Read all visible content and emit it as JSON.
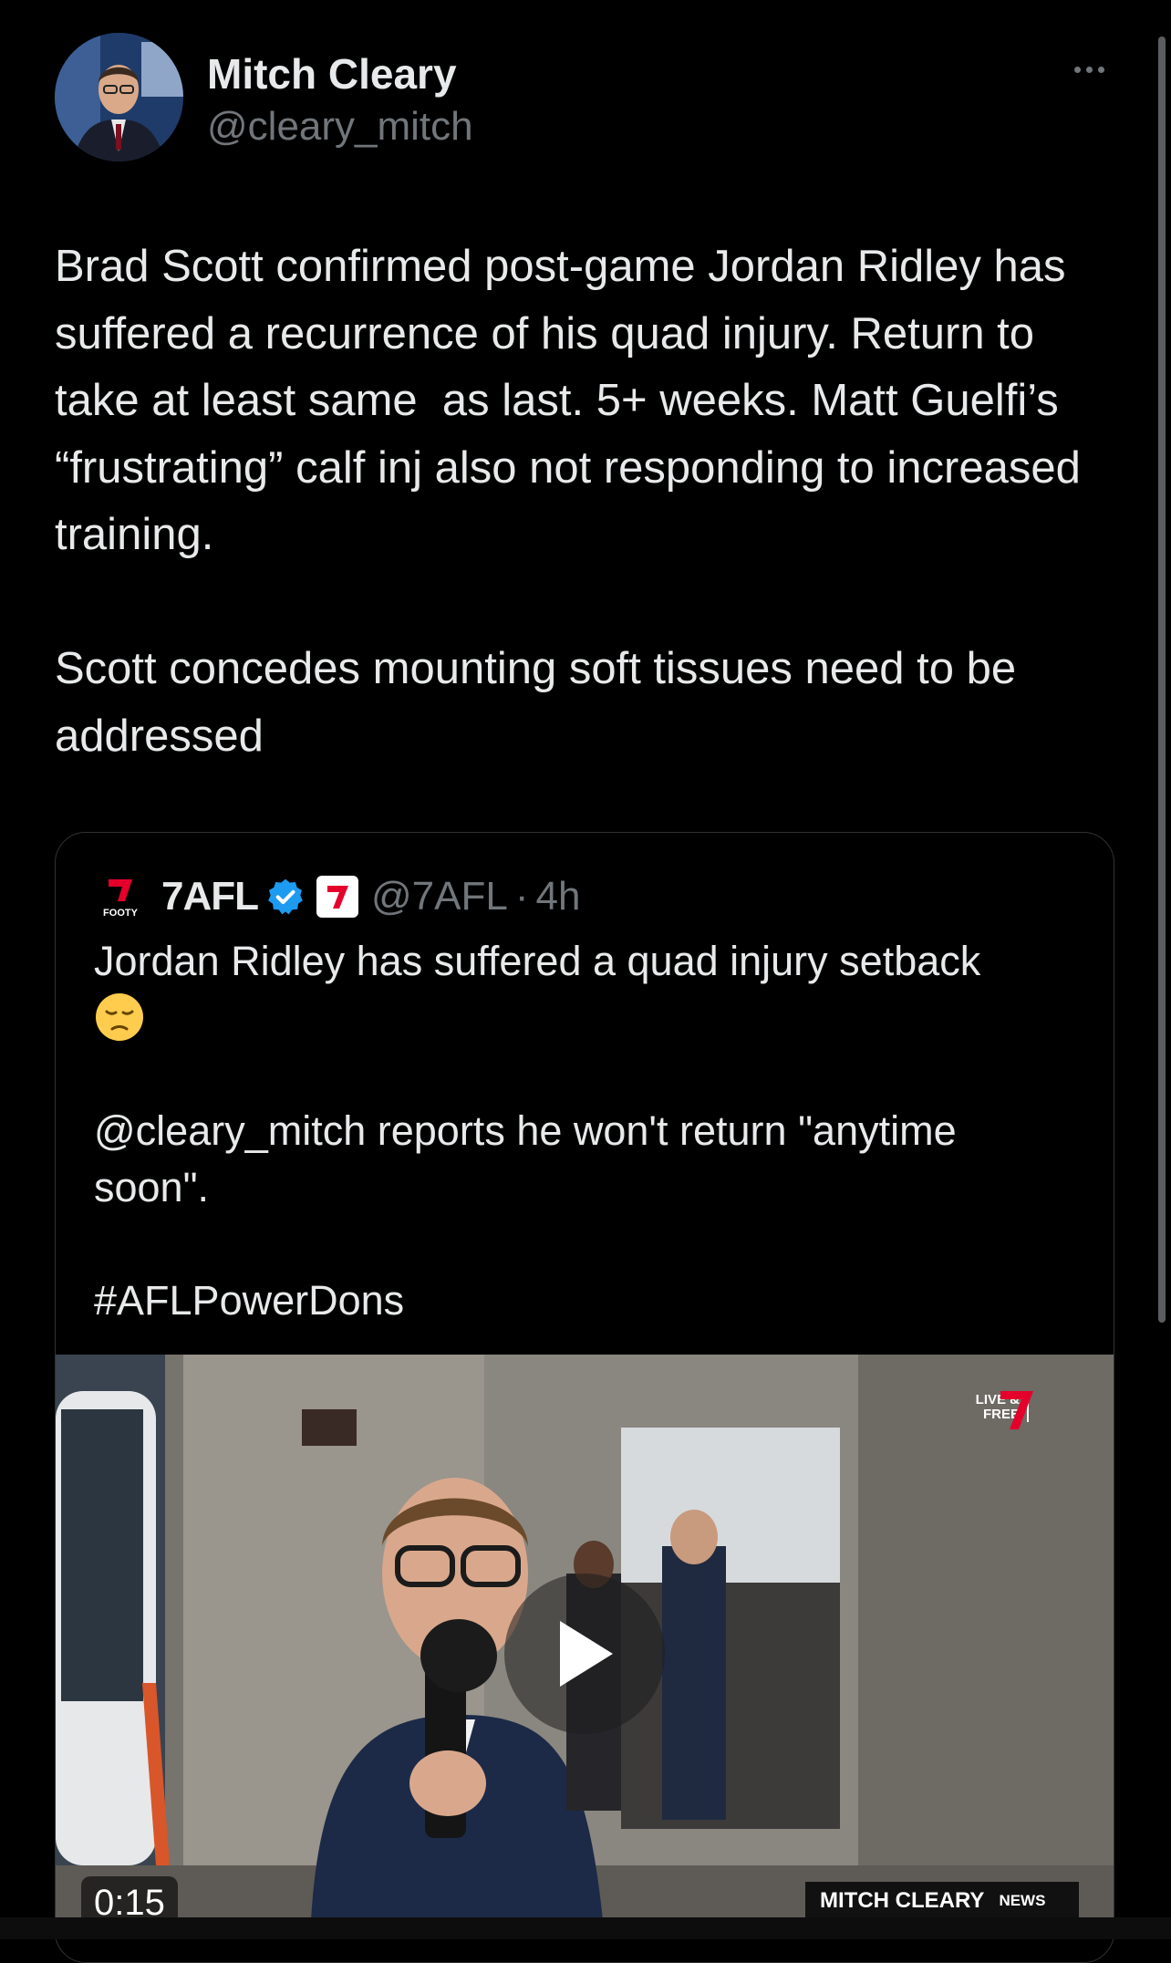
{
  "author": {
    "name": "Mitch Cleary",
    "handle": "@cleary_mitch"
  },
  "tweet": {
    "text": "Brad Scott confirmed post-game Jordan Ridley has suffered a recurrence of his quad injury. Return to take at least same  as last. 5+ weeks. Matt Guelfi’s “frustrating” calf inj also not responding to increased training.\n\nScott concedes mounting soft tissues need to be addressed"
  },
  "quote": {
    "name": "7AFL",
    "handle": "@7AFL",
    "separator": "·",
    "time": "4h",
    "text_line1": "Jordan Ridley has suffered a quad injury setback",
    "text_rest": "@cleary_mitch reports he won't return \"anytime soon\".\n\n#AFLPowerDons",
    "logo_text": "FOOTY",
    "media": {
      "duration": "0:15",
      "live_free": "LIVE & FREE",
      "lower_third_name": "MITCH CLEARY",
      "news_tag": "NEWS"
    }
  },
  "colors": {
    "background": "#000000",
    "text": "#e7e9ea",
    "secondary": "#71767b",
    "border": "#2f3336",
    "verified": "#1d9bf0",
    "seven_red": "#e4002b"
  }
}
